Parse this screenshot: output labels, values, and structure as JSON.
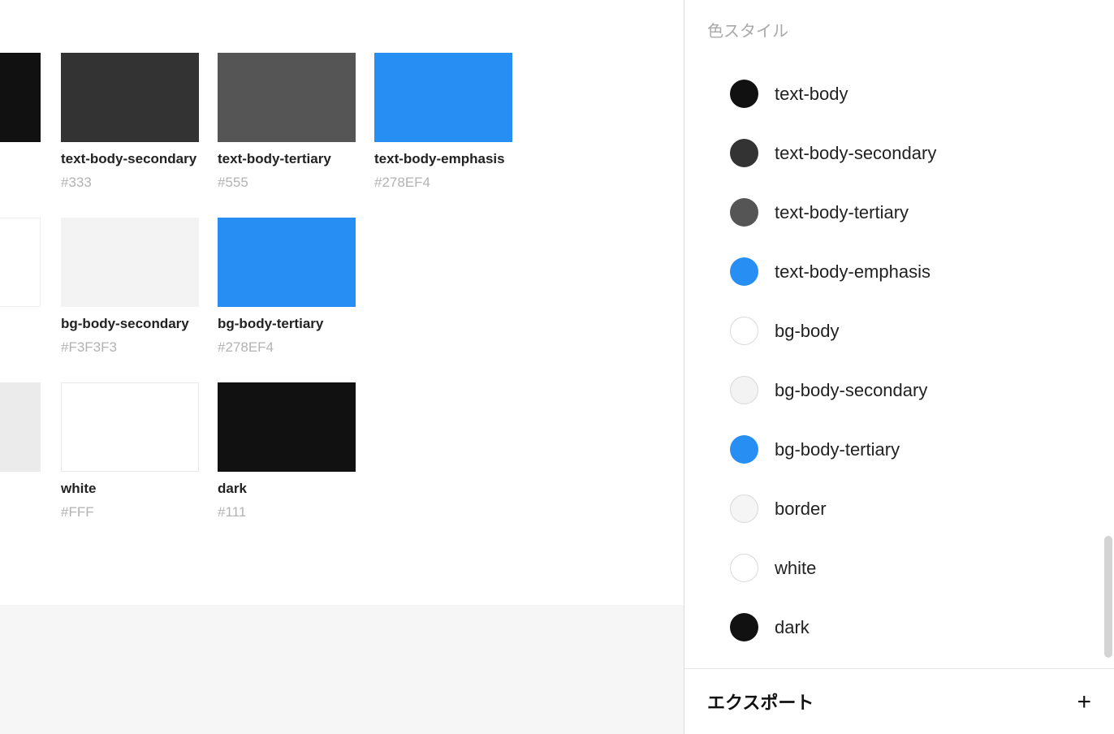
{
  "canvas": {
    "rows": [
      {
        "partial": {
          "color": "#111111"
        },
        "cards": [
          {
            "name": "text-body-secondary",
            "hex": "#333",
            "color": "#333333",
            "border": false
          },
          {
            "name": "text-body-tertiary",
            "hex": "#555",
            "color": "#555555",
            "border": false
          },
          {
            "name": "text-body-emphasis",
            "hex": "#278EF4",
            "color": "#278EF4",
            "border": false
          }
        ]
      },
      {
        "partial": {
          "color": "#FFFFFF"
        },
        "cards": [
          {
            "name": "bg-body-secondary",
            "hex": "#F3F3F3",
            "color": "#F3F3F3",
            "border": false
          },
          {
            "name": "bg-body-tertiary",
            "hex": "#278EF4",
            "color": "#278EF4",
            "border": false
          }
        ]
      },
      {
        "partial": {
          "color": "#EBEBEB"
        },
        "cards": [
          {
            "name": "white",
            "hex": "#FFF",
            "color": "#FFFFFF",
            "border": true
          },
          {
            "name": "dark",
            "hex": "#111",
            "color": "#111111",
            "border": false
          }
        ]
      }
    ]
  },
  "panel": {
    "header": "色スタイル",
    "styles": [
      {
        "label": "text-body",
        "color": "#111111",
        "border": false
      },
      {
        "label": "text-body-secondary",
        "color": "#333333",
        "border": false
      },
      {
        "label": "text-body-tertiary",
        "color": "#555555",
        "border": false
      },
      {
        "label": "text-body-emphasis",
        "color": "#278EF4",
        "border": false
      },
      {
        "label": "bg-body",
        "color": "#FFFFFF",
        "border": true
      },
      {
        "label": "bg-body-secondary",
        "color": "#F3F3F3",
        "border": true
      },
      {
        "label": "bg-body-tertiary",
        "color": "#278EF4",
        "border": false
      },
      {
        "label": "border",
        "color": "#F5F5F5",
        "border": true
      },
      {
        "label": "white",
        "color": "#FFFFFF",
        "border": true
      },
      {
        "label": "dark",
        "color": "#111111",
        "border": false
      }
    ],
    "export": {
      "title": "エクスポート"
    }
  }
}
